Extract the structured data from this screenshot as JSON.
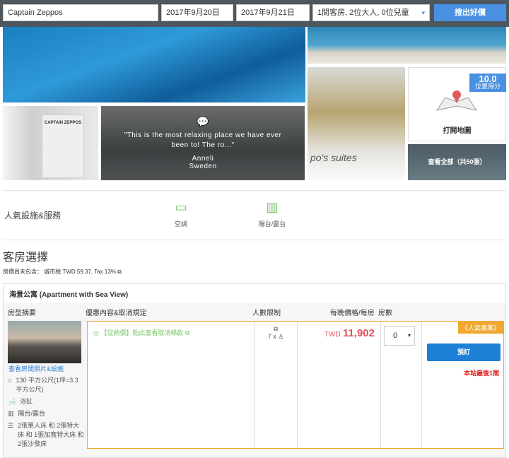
{
  "search": {
    "hotel": "Captain Zeppos",
    "checkin": "2017年9月20日",
    "checkout": "2017年9月21日",
    "guests": "1間客房, 2位大人, 0位兒童",
    "button": "搜出好價"
  },
  "gallery": {
    "quote": "\"This is the most relaxing place we have ever been to! The ro...\"",
    "reviewer": "Anneli",
    "country": "Sweden",
    "score": "10.0",
    "score_label": "位置得分",
    "map_label": "打開地圖",
    "view_all": "查看全部（共50張）",
    "book_text": "CAPTAIN ZEPPOS",
    "sign_text": "po's suites"
  },
  "amenities": {
    "title": "人氣設施&服務",
    "items": [
      {
        "label": "空調",
        "icon": "air-conditioner-icon"
      },
      {
        "label": "陽台/露台",
        "icon": "balcony-icon"
      }
    ]
  },
  "rooms": {
    "title": "客房選擇",
    "tax_label": "房價尚未包含：",
    "tax_value": "城市稅 TWD 59.37, Tax 13%",
    "room": {
      "name": "海景公寓 (Apartment with Sea View)",
      "headers": [
        "房型摘要",
        "優惠內容&取消規定",
        "人數限制",
        "每晚價格/每房",
        "房數"
      ],
      "photos_link": "查看房間照片&設施",
      "features": [
        "130 平方公尺(1坪=3.3平方公尺)",
        "浴缸",
        "陽台/露台",
        "2張單人床 和 2張特大床 和 1張加寬特大床 和 2張沙發床"
      ],
      "offer": "【促銷價】點此查看取消條款",
      "occupancy": "7 x",
      "currency": "TWD",
      "price": "11,902",
      "qty": "0",
      "badge": "《人氣專案》",
      "book": "預訂",
      "scarcity": "本站最後1間"
    }
  }
}
